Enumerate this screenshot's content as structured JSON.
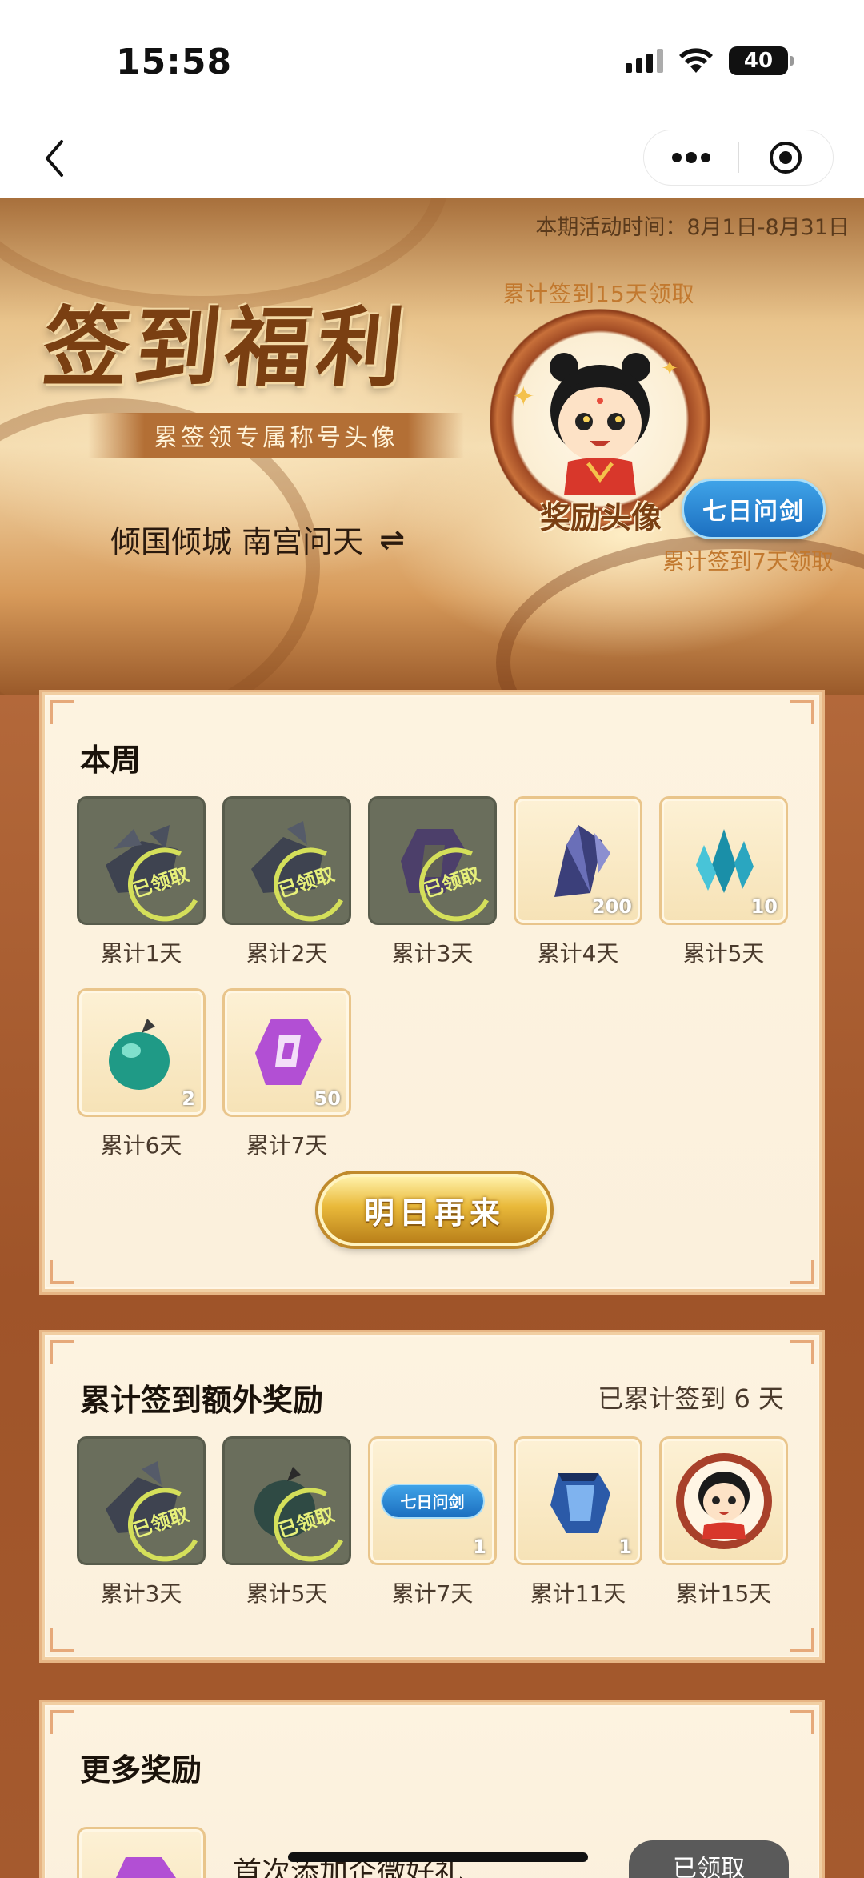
{
  "status": {
    "time": "15:58",
    "battery": "40"
  },
  "hero": {
    "period": "本期活动时间：8月1日-8月31日",
    "title": "签到福利",
    "subtitle": "累签领专属称号头像",
    "account": "倾国倾城  南宫问天",
    "swap_symbol": "⇌",
    "claim15": "累计签到15天领取",
    "avatar_label": "奖励头像",
    "title_badge": "七日问剑",
    "claim7": "累计签到7天领取"
  },
  "weekly": {
    "title": "本周",
    "items": [
      {
        "label": "累计1天",
        "state": "claimed",
        "icon": "grey-treasure-icon",
        "stamp": "已领取"
      },
      {
        "label": "累计2天",
        "state": "claimed",
        "icon": "grey-treasure-icon",
        "stamp": "已领取"
      },
      {
        "label": "累计3天",
        "state": "claimed",
        "icon": "purple-rune-icon",
        "stamp": "已领取"
      },
      {
        "label": "累计4天",
        "state": "active",
        "icon": "dark-crystal-icon",
        "qty": "200"
      },
      {
        "label": "累计5天",
        "state": "active",
        "icon": "cyan-crystal-icon",
        "qty": "10"
      },
      {
        "label": "累计6天",
        "state": "active",
        "icon": "green-fruit-icon",
        "qty": "2"
      },
      {
        "label": "累计7天",
        "state": "active",
        "icon": "purple-rune-icon",
        "qty": "50"
      }
    ],
    "button": "明日再来"
  },
  "extra": {
    "title": "累计签到额外奖励",
    "progress": "已累计签到 6 天",
    "items": [
      {
        "label": "累计3天",
        "state": "claimed",
        "icon": "grey-treasure-icon",
        "stamp": "已领取"
      },
      {
        "label": "累计5天",
        "state": "claimed",
        "icon": "green-fruit-icon",
        "stamp": "已领取"
      },
      {
        "label": "累计7天",
        "state": "active",
        "icon": "title-badge-icon",
        "badge": "七日问剑",
        "qty": "1"
      },
      {
        "label": "累计11天",
        "state": "active",
        "icon": "blue-cloak-icon",
        "qty": "1"
      },
      {
        "label": "累计15天",
        "state": "active",
        "icon": "avatar-icon"
      }
    ]
  },
  "more": {
    "title": "更多奖励",
    "item_name": "首次添加企微好礼",
    "float_button": "已领取"
  },
  "colors": {
    "accent": "#e9b93a",
    "panel": "#fdf3e0",
    "claimed_tile": "#6a6e5c",
    "badge_blue": "#1c6fc0"
  }
}
